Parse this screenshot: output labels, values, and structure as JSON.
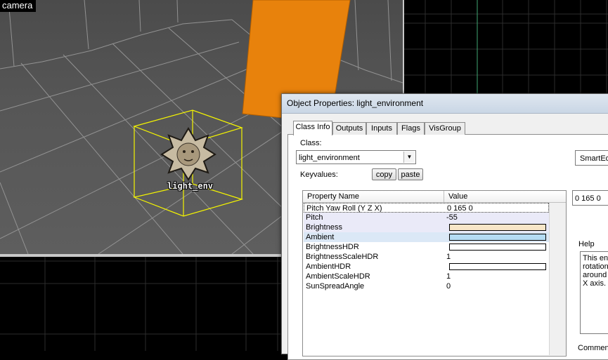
{
  "viewport": {
    "camera_label": "camera",
    "entity_label": "light_env",
    "colors": {
      "brush": "#e8820c",
      "selection": "#f5f500",
      "grid": "#2a2a2a",
      "grid_axis": "#3fa873"
    }
  },
  "dialog": {
    "title": "Object Properties: light_environment",
    "tabs": [
      {
        "label": "Class Info",
        "active": true
      },
      {
        "label": "Outputs",
        "active": false
      },
      {
        "label": "Inputs",
        "active": false
      },
      {
        "label": "Flags",
        "active": false
      },
      {
        "label": "VisGroup",
        "active": false
      }
    ],
    "class_label": "Class:",
    "class_value": "light_environment",
    "keyvalues_label": "Keyvalues:",
    "copy_label": "copy",
    "paste_label": "paste",
    "smartedit_label": "SmartEd",
    "columns": {
      "name": "Property Name",
      "value": "Value"
    },
    "properties": [
      {
        "name": "Pitch Yaw Roll (Y Z X)",
        "value": "0 165 0"
      },
      {
        "name": "Pitch",
        "value": "-55"
      },
      {
        "name": "Brightness",
        "value": "",
        "color": "#f8e6c8"
      },
      {
        "name": "Ambient",
        "value": "",
        "color": "#b4dcf4"
      },
      {
        "name": "BrightnessHDR",
        "value": "",
        "color": "#ffffff"
      },
      {
        "name": "BrightnessScaleHDR",
        "value": "1"
      },
      {
        "name": "AmbientHDR",
        "value": "",
        "color": "#ffffff"
      },
      {
        "name": "AmbientScaleHDR",
        "value": "1"
      },
      {
        "name": "SunSpreadAngle",
        "value": "0"
      }
    ],
    "value_field": "0 165 0",
    "help_label": "Help",
    "help_text": "This ent\nrotation\naround t\nX axis.",
    "comments_label": "Comment"
  }
}
